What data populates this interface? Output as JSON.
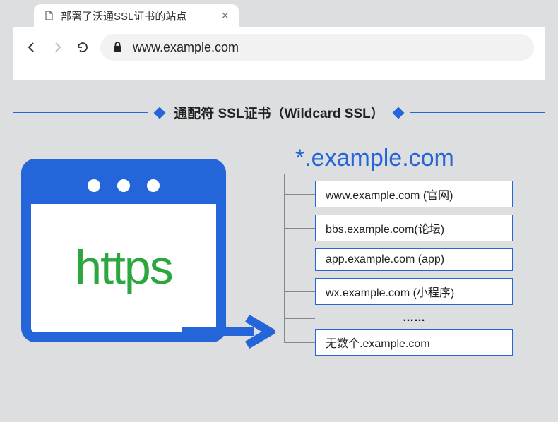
{
  "browser": {
    "tab_title": "部署了沃通SSL证书的站点",
    "url": "www.example.com"
  },
  "section_title": "通配符 SSL证书（Wildcard SSL）",
  "https_label": "https",
  "wildcard_domain": "*.example.com",
  "subdomains": [
    "www.example.com (官网)",
    "bbs.example.com(论坛)",
    "app.example.com (app)",
    "wx.example.com (小程序)"
  ],
  "ellipsis": "……",
  "final_item": "无数个.example.com",
  "colors": {
    "accent": "#2565da",
    "https_green": "#2ca63f"
  }
}
